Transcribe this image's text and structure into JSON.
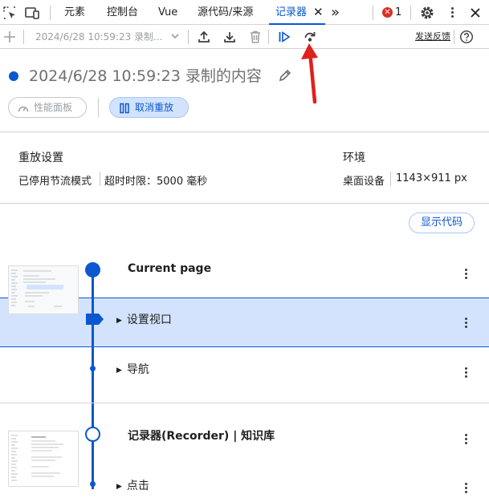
{
  "tabbar": {
    "tabs": [
      {
        "label": "元素"
      },
      {
        "label": "控制台"
      },
      {
        "label": "Vue"
      },
      {
        "label": "源代码/来源"
      },
      {
        "label": "记录器",
        "active": true
      }
    ],
    "close_glyph": "✕",
    "more_tabs_glyph": "»",
    "error_count": "1",
    "icons": [
      "inspect-icon",
      "device-toggle-icon",
      "error-icon",
      "gear-icon",
      "kebab-menu-icon",
      "close-icon"
    ]
  },
  "toolbar": {
    "recording_select": "2024/6/28 10:59:23 录制...",
    "feedback_label": "发送反馈",
    "icons": [
      "add-icon",
      "dropdown-chevron-icon",
      "export-icon",
      "import-icon",
      "delete-icon",
      "replay-icon",
      "replay-step-icon",
      "help-icon"
    ]
  },
  "recording": {
    "title": "2024/6/28 10:59:23 录制的内容",
    "perf_panel_label": "性能面板",
    "cancel_replay_label": "取消重放"
  },
  "settings": {
    "replay_heading": "重放设置",
    "throttle_label": "已停用节流模式",
    "timeout_label": "超时时限：5000 毫秒",
    "env_heading": "环境",
    "device_label": "桌面设备",
    "viewport_label": "1143×911 px"
  },
  "show_code_label": "显示代码",
  "steps": [
    {
      "kind": "section",
      "title": "Current page"
    },
    {
      "kind": "step",
      "label": "设置视口",
      "selected": true
    },
    {
      "kind": "step",
      "label": "导航"
    },
    {
      "kind": "section",
      "title": "记录器(Recorder) | 知识库"
    },
    {
      "kind": "step",
      "label": "点击"
    }
  ],
  "colors": {
    "accent": "#0b57d0",
    "selected_bg": "#d3e3fd",
    "error": "#d93025",
    "annotation_arrow": "#e0201b"
  }
}
